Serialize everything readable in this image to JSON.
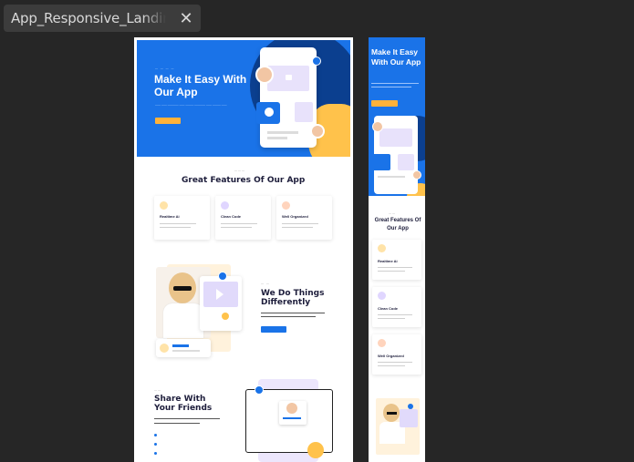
{
  "tab": {
    "title": "App_Responsive_Landing"
  },
  "desktop": {
    "hero": {
      "title": "Make It Easy With Our App"
    },
    "features": {
      "title": "Great Features Of Our App",
      "cards": [
        {
          "title": "Realtime Ai",
          "color": "#ffb23a"
        },
        {
          "title": "Clean Code",
          "color": "#8a6cf0"
        },
        {
          "title": "Well Organized",
          "color": "#ff7a3a"
        }
      ]
    },
    "about": {
      "title": "We Do Things Differently"
    },
    "share": {
      "title": "Share With Your Friends"
    }
  },
  "mobile": {
    "hero": {
      "title": "Make It Easy With Our App"
    },
    "features": {
      "title": "Great Features Of Our App",
      "cards": [
        {
          "title": "Realtime Ai",
          "color": "#ffb23a"
        },
        {
          "title": "Clean Code",
          "color": "#8a6cf0"
        },
        {
          "title": "Well Organized",
          "color": "#ff7a3a"
        }
      ]
    }
  },
  "colors": {
    "accent_blue": "#1a73e8",
    "navy": "#0b3f8f",
    "yellow": "#ffc24b",
    "lavender": "#e8e2fb"
  },
  "icons": [
    "close-icon",
    "play-icon",
    "search-icon",
    "lock-icon"
  ]
}
